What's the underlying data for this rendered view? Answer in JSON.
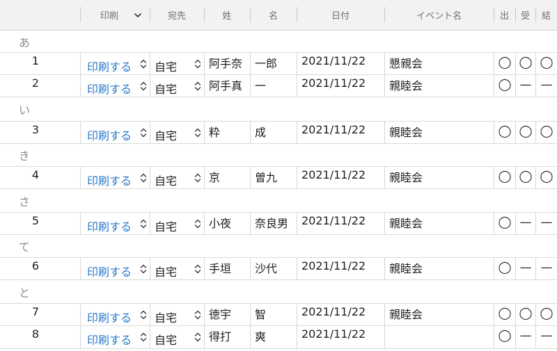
{
  "header": {
    "print": "印刷",
    "dest": "宛先",
    "sei": "姓",
    "mei": "名",
    "date": "日付",
    "event": "イベント名",
    "m1": "出",
    "m2": "受",
    "m3": "結"
  },
  "groups": [
    {
      "label": "あ"
    },
    {
      "label": "い"
    },
    {
      "label": "き"
    },
    {
      "label": "さ"
    },
    {
      "label": "て"
    },
    {
      "label": "と"
    }
  ],
  "rows": [
    {
      "num": "1",
      "print": "印刷する",
      "dest": "自宅",
      "sei": "阿手奈",
      "mei": "一郎",
      "date": "2021/11/22",
      "event": "懇親会",
      "m1": "◯",
      "m2": "◯",
      "m3": "◯"
    },
    {
      "num": "2",
      "print": "印刷する",
      "dest": "自宅",
      "sei": "阿手真",
      "mei": "一",
      "date": "2021/11/22",
      "event": "親睦会",
      "m1": "◯",
      "m2": "—",
      "m3": "—"
    },
    {
      "num": "3",
      "print": "印刷する",
      "dest": "自宅",
      "sei": "粋",
      "mei": "成",
      "date": "2021/11/22",
      "event": "親睦会",
      "m1": "◯",
      "m2": "◯",
      "m3": "◯"
    },
    {
      "num": "4",
      "print": "印刷する",
      "dest": "自宅",
      "sei": "京",
      "mei": "曽九",
      "date": "2021/11/22",
      "event": "親睦会",
      "m1": "◯",
      "m2": "◯",
      "m3": "◯"
    },
    {
      "num": "5",
      "print": "印刷する",
      "dest": "自宅",
      "sei": "小夜",
      "mei": "奈良男",
      "date": "2021/11/22",
      "event": "親睦会",
      "m1": "◯",
      "m2": "—",
      "m3": "—"
    },
    {
      "num": "6",
      "print": "印刷する",
      "dest": "自宅",
      "sei": "手垣",
      "mei": "沙代",
      "date": "2021/11/22",
      "event": "親睦会",
      "m1": "◯",
      "m2": "—",
      "m3": "—"
    },
    {
      "num": "7",
      "print": "印刷する",
      "dest": "自宅",
      "sei": "徳宇",
      "mei": "智",
      "date": "2021/11/22",
      "event": "親睦会",
      "m1": "◯",
      "m2": "◯",
      "m3": "◯"
    },
    {
      "num": "8",
      "print": "印刷する",
      "dest": "自宅",
      "sei": "得打",
      "mei": "爽",
      "date": "2021/11/22",
      "event": "",
      "m1": "◯",
      "m2": "—",
      "m3": "—"
    }
  ]
}
